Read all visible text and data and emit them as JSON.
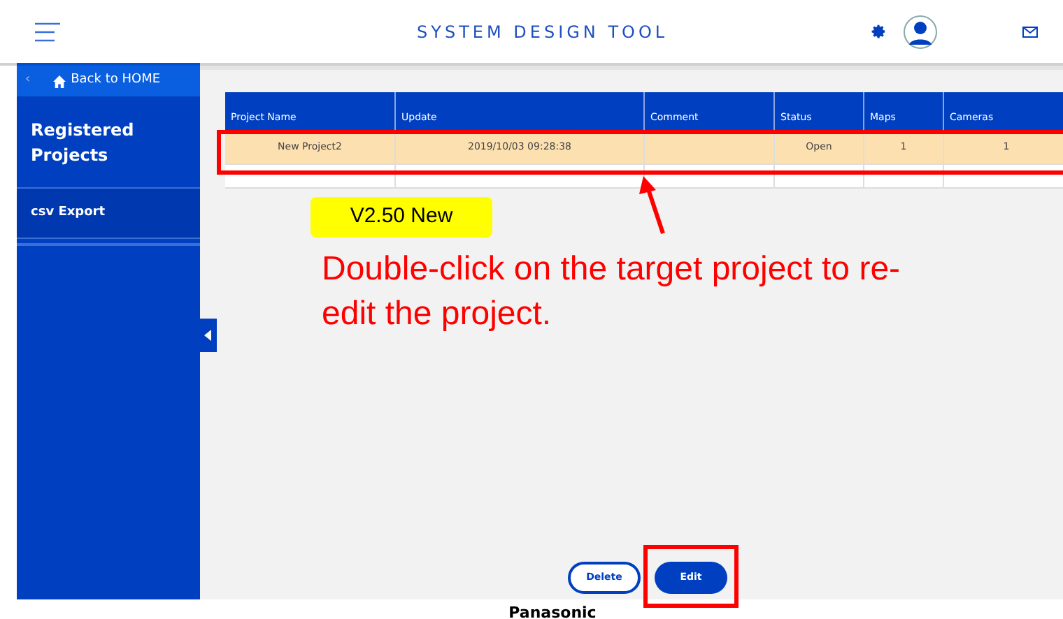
{
  "header": {
    "title": "SYSTEM DESIGN TOOL"
  },
  "sidebar": {
    "back_chevron": "‹",
    "back": "Back to HOME",
    "items": [
      {
        "label": "Registered Projects",
        "selected": true
      },
      {
        "label": "csv Export",
        "selected": false
      }
    ]
  },
  "table": {
    "columns": [
      "Project Name",
      "Update",
      "Comment",
      "Status",
      "Maps",
      "Cameras"
    ],
    "rows": [
      {
        "selected": true,
        "cells": [
          "New Project2",
          "2019/10/03 09:28:38",
          "",
          "Open",
          "1",
          "1"
        ]
      },
      {
        "selected": false
      }
    ]
  },
  "annotation": {
    "badge": "V2.50 New",
    "note": "Double-click on the target project to re-edit the project."
  },
  "buttons": [
    {
      "label": "Delete",
      "kind": "outline"
    },
    {
      "label": "Edit",
      "kind": "primary"
    }
  ],
  "footer": {
    "brand": "Panasonic"
  }
}
